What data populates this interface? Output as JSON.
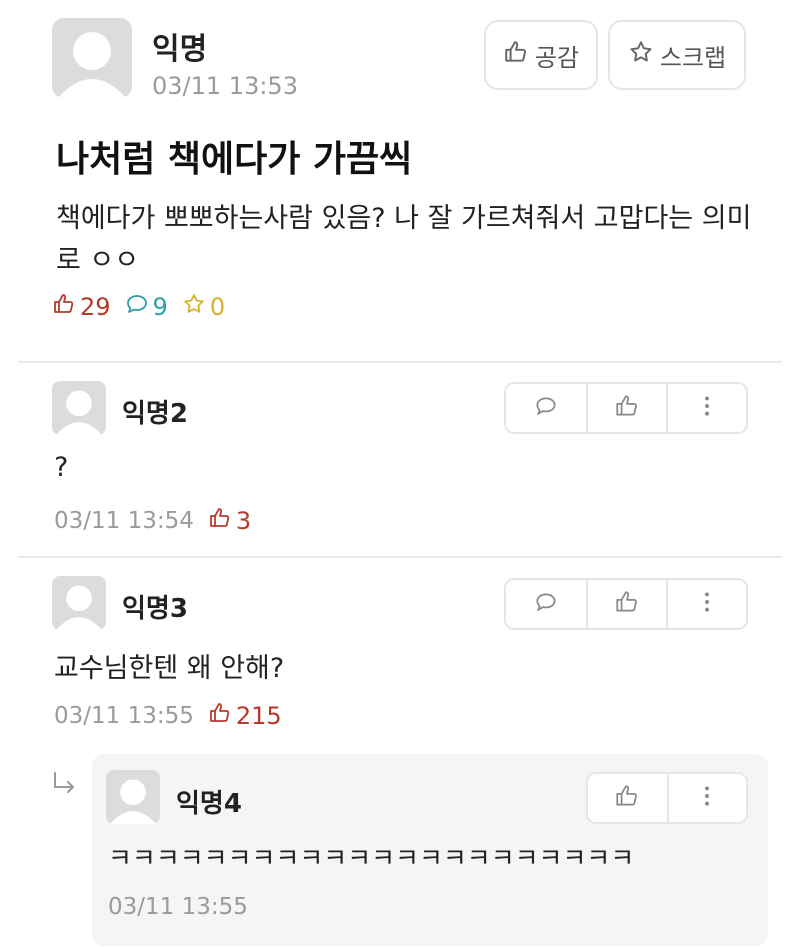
{
  "post": {
    "author": "익명",
    "time": "03/11 13:53",
    "like_button_label": "공감",
    "scrap_button_label": "스크랩",
    "title": "나처럼 책에다가 가끔씩",
    "body": "책에다가 뽀뽀하는사람 있음? 나 잘 가르쳐줘서 고맙다는 의미로 ㅇㅇ",
    "likes": "29",
    "comments": "9",
    "scraps": "0"
  },
  "comments": [
    {
      "author": "익명2",
      "text": "?",
      "time": "03/11 13:54",
      "likes": "3"
    },
    {
      "author": "익명3",
      "text": "교수님한텐 왜 안해?",
      "time": "03/11 13:55",
      "likes": "215"
    }
  ],
  "reply": {
    "author": "익명4",
    "text": "ㅋㅋㅋㅋㅋㅋㅋㅋㅋㅋㅋㅋㅋㅋㅋㅋㅋㅋㅋㅋㅋㅋ",
    "time": "03/11 13:55"
  },
  "colors": {
    "like": "#b63a2c",
    "comment": "#2f9ea6",
    "scrap": "#d7b22a",
    "meta": "#9a9a9a"
  },
  "icons": [
    "avatar-placeholder",
    "thumbs-up-icon",
    "star-icon",
    "speech-bubble-icon",
    "more-vertical-icon",
    "reply-arrow-icon"
  ]
}
